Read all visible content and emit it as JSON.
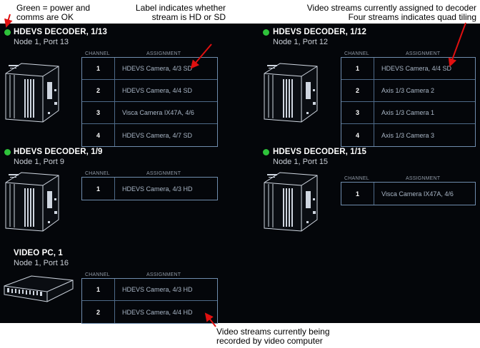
{
  "annotations": {
    "status": [
      "Green = power and",
      "comms are OK"
    ],
    "label": [
      "Label indicates whether",
      "stream is HD or SD"
    ],
    "assigned": [
      "Video streams currently assigned to decoder",
      "Four streams indicates quad tiling"
    ],
    "recorded": [
      "Video streams currently being",
      "recorded by video computer"
    ]
  },
  "columns": {
    "channel": "CHANNEL",
    "assignment": "ASSIGNMENT"
  },
  "colors": {
    "ok_status": "#2ec23a",
    "annotation_arrow": "#e01010"
  },
  "devices": [
    {
      "title": "HDEVS DECODER, 1/13",
      "subtitle": "Node 1, Port 13",
      "status": "ok",
      "rows": [
        {
          "ch": "1",
          "a": "HDEVS Camera, 4/3 SD"
        },
        {
          "ch": "2",
          "a": "HDEVS Camera, 4/4 SD"
        },
        {
          "ch": "3",
          "a": "Visca Camera IX47A, 4/6"
        },
        {
          "ch": "4",
          "a": "HDEVS Camera, 4/7 SD"
        }
      ]
    },
    {
      "title": "HDEVS DECODER, 1/12",
      "subtitle": "Node 1, Port 12",
      "status": "ok",
      "rows": [
        {
          "ch": "1",
          "a": "HDEVS Camera, 4/4 SD"
        },
        {
          "ch": "2",
          "a": "Axis 1/3 Camera 2"
        },
        {
          "ch": "3",
          "a": "Axis 1/3 Camera 1"
        },
        {
          "ch": "4",
          "a": "Axis 1/3 Camera 3"
        }
      ]
    },
    {
      "title": "HDEVS DECODER, 1/9",
      "subtitle": "Node 1, Port 9",
      "status": "ok",
      "rows": [
        {
          "ch": "1",
          "a": "HDEVS Camera, 4/3 HD"
        }
      ]
    },
    {
      "title": "HDEVS DECODER, 1/15",
      "subtitle": "Node 1, Port 15",
      "status": "ok",
      "rows": [
        {
          "ch": "1",
          "a": "Visca Camera IX47A, 4/6"
        }
      ]
    },
    {
      "title": "VIDEO PC, 1",
      "subtitle": "Node 1, Port 16",
      "status": "none",
      "rows": [
        {
          "ch": "1",
          "a": "HDEVS Camera, 4/3 HD"
        },
        {
          "ch": "2",
          "a": "HDEVS Camera, 4/4 HD"
        }
      ]
    }
  ]
}
